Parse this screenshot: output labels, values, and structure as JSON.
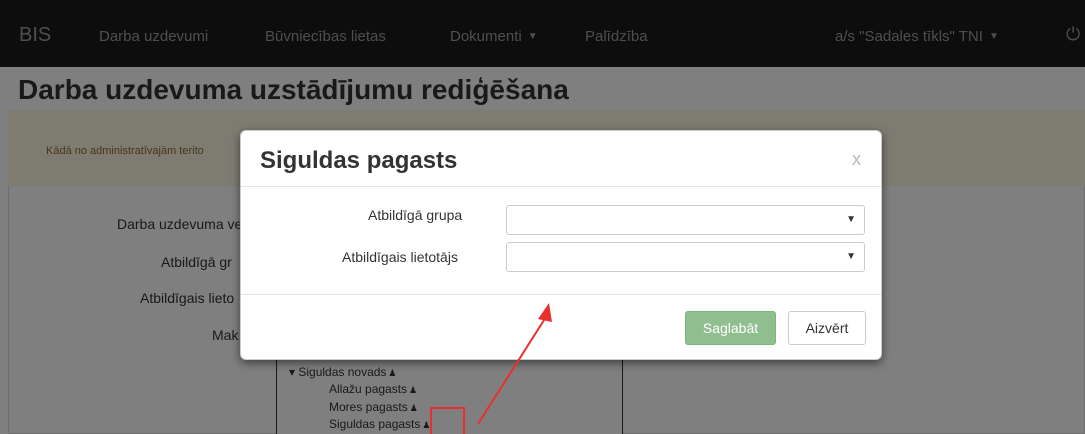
{
  "navbar": {
    "brand": "BIS",
    "items": [
      {
        "label": "Darba uzdevumi"
      },
      {
        "label": "Būvniecības lietas"
      },
      {
        "label": "Dokumenti"
      },
      {
        "label": "Palīdzība"
      }
    ],
    "user": "a/s \"Sadales tīkls\" TNI"
  },
  "page": {
    "title": "Darba uzdevuma uzstādījumu rediģēšana",
    "hint": "Kādā no administratīvajām terito",
    "labels": [
      "Darba uzdevuma ve",
      "Atbildīgā gr",
      "Atbildīgais lieto",
      "Mak"
    ],
    "tree": [
      {
        "label": "▾ Siguldas novads"
      },
      {
        "label": "Allažu pagasts"
      },
      {
        "label": "Mores pagasts"
      },
      {
        "label": "Siguldas pagasts"
      }
    ]
  },
  "modal": {
    "title": "Siguldas pagasts",
    "close": "x",
    "fields": [
      {
        "label": "Atbildīgā grupa",
        "value": ""
      },
      {
        "label": "Atbildīgais lietotājs",
        "value": ""
      }
    ],
    "save_label": "Saglabāt",
    "close_label": "Aizvērt"
  },
  "colors": {
    "navbar": "#1b1b1b",
    "save_button": "#8fbf8f",
    "annotation": "#e8302e"
  }
}
